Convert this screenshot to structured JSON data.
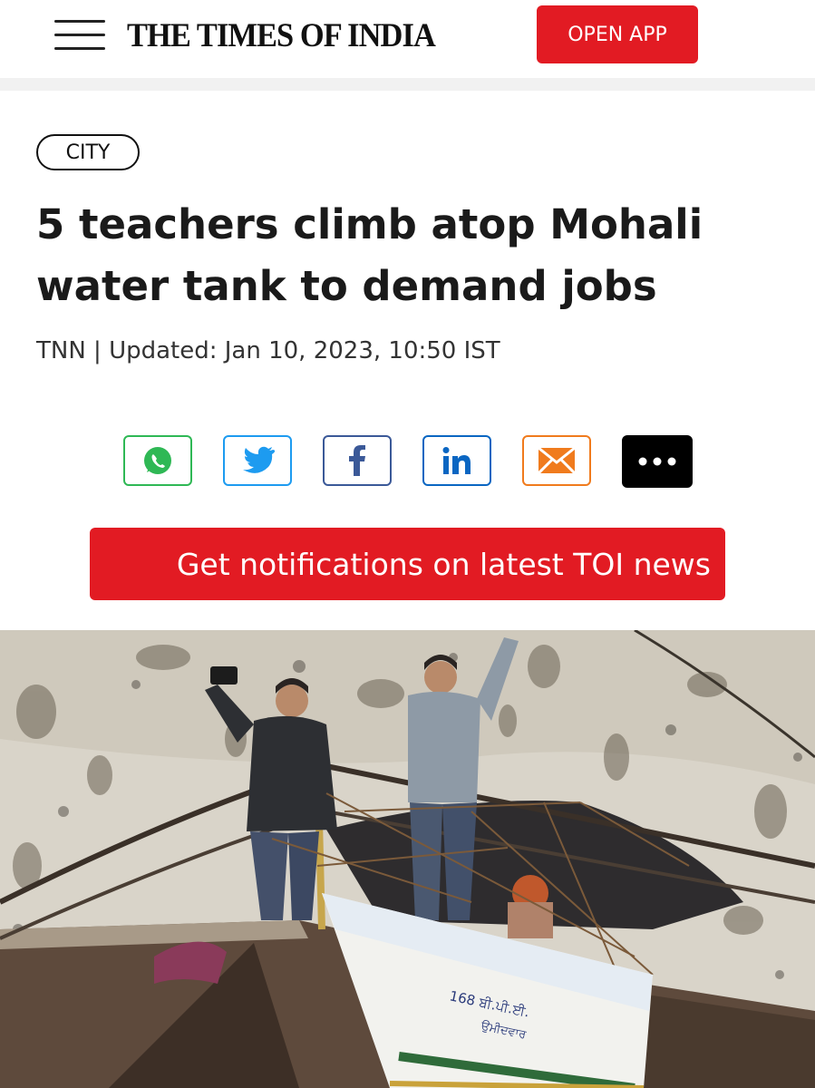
{
  "header": {
    "menu_icon": "hamburger-menu-icon",
    "logo_text": "THE TIMES OF INDIA",
    "open_app_label": "OPEN APP"
  },
  "article": {
    "category": "CITY",
    "headline": "5 teachers climb atop Mohali water tank to demand jobs",
    "byline": "TNN | Updated: Jan 10, 2023, 10:50 IST"
  },
  "share": [
    {
      "icon": "whatsapp-icon",
      "color": "#2fb855"
    },
    {
      "icon": "twitter-icon",
      "color": "#1d9bf0"
    },
    {
      "icon": "facebook-icon",
      "color": "#3b5998"
    },
    {
      "icon": "linkedin-icon",
      "color": "#0a66c2"
    },
    {
      "icon": "email-icon",
      "color": "#f07b1d"
    },
    {
      "icon": "more-icon",
      "color": "#000000"
    }
  ],
  "notify_label": "Get notifications on latest TOI news",
  "photo": {
    "banner_text_1": "168 ਬੀ.ਪੀ.ਈ.",
    "banner_text_2": "ਉਮੀਦਵਾਰ"
  },
  "colors": {
    "brand_red": "#e21b23",
    "text_dark": "#1a1a1a"
  }
}
